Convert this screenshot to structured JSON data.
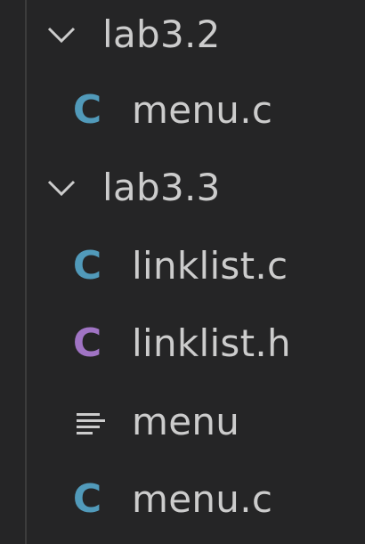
{
  "tree": {
    "folders": [
      {
        "label": "lab3.2",
        "expanded": true,
        "files": [
          {
            "icon": "c-file-icon",
            "icon_glyph": "C",
            "icon_color": "#519aba",
            "label": "menu.c"
          }
        ]
      },
      {
        "label": "lab3.3",
        "expanded": true,
        "files": [
          {
            "icon": "c-file-icon",
            "icon_glyph": "C",
            "icon_color": "#519aba",
            "label": "linklist.c"
          },
          {
            "icon": "c-header-icon",
            "icon_glyph": "C",
            "icon_color": "#a074c4",
            "label": "linklist.h"
          },
          {
            "icon": "text-lines-icon",
            "icon_glyph": "",
            "icon_color": "#cccccc",
            "label": "menu"
          },
          {
            "icon": "c-file-icon",
            "icon_glyph": "C",
            "icon_color": "#519aba",
            "label": "menu.c"
          }
        ]
      }
    ]
  }
}
